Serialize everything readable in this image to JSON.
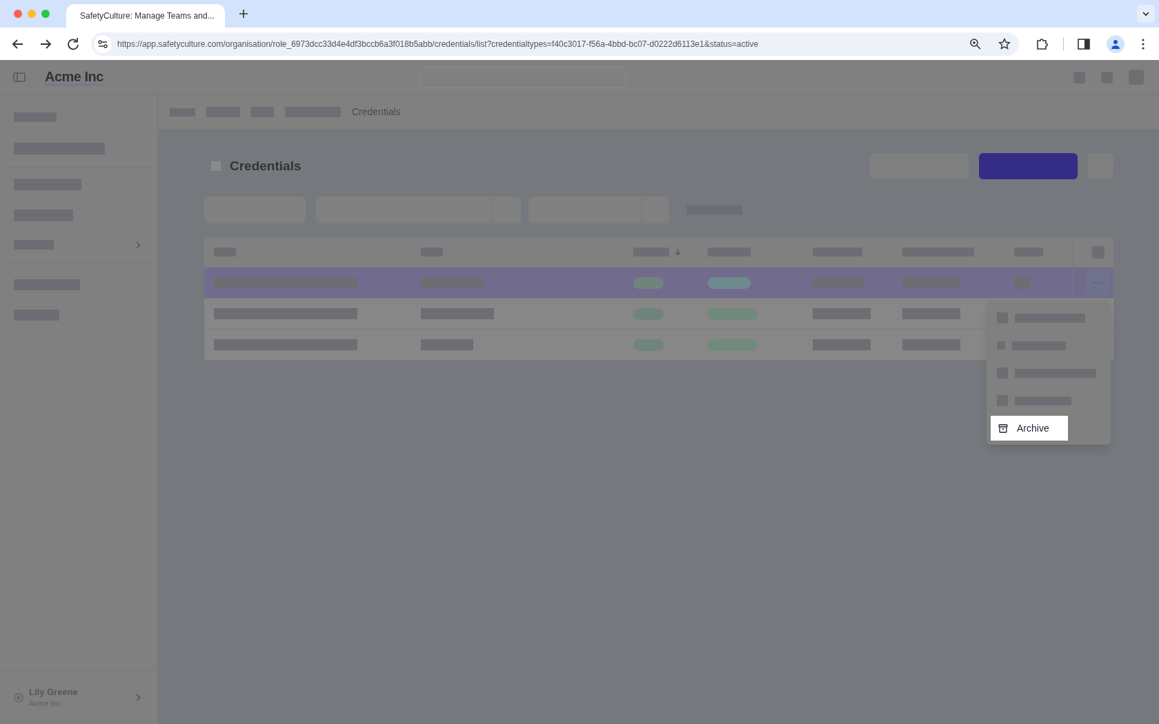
{
  "browser": {
    "tab_title": "SafetyCulture: Manage Teams and...",
    "url": "https://app.safetyculture.com/organisation/role_6973dcc33d4e4df3bccb6a3f018b5abb/credentials/list?credentialtypes=f40c3017-f56a-4bbd-bc07-d0222d6113e1&status=active"
  },
  "app": {
    "name": "Acme Inc"
  },
  "breadcrumb": {
    "current": "Credentials"
  },
  "page": {
    "title": "Credentials"
  },
  "table": {
    "rows": [
      {
        "selected": true
      },
      {
        "selected": false
      },
      {
        "selected": false
      }
    ]
  },
  "menu": {
    "items": [
      {
        "kind": "placeholder",
        "highlighted": false
      },
      {
        "kind": "placeholder",
        "highlighted": false
      },
      {
        "kind": "placeholder",
        "highlighted": false
      },
      {
        "kind": "placeholder",
        "highlighted": false
      },
      {
        "kind": "action",
        "label": "Archive",
        "highlighted": true
      }
    ]
  },
  "user": {
    "name": "Lily Greene",
    "org": "Acme Inc."
  }
}
